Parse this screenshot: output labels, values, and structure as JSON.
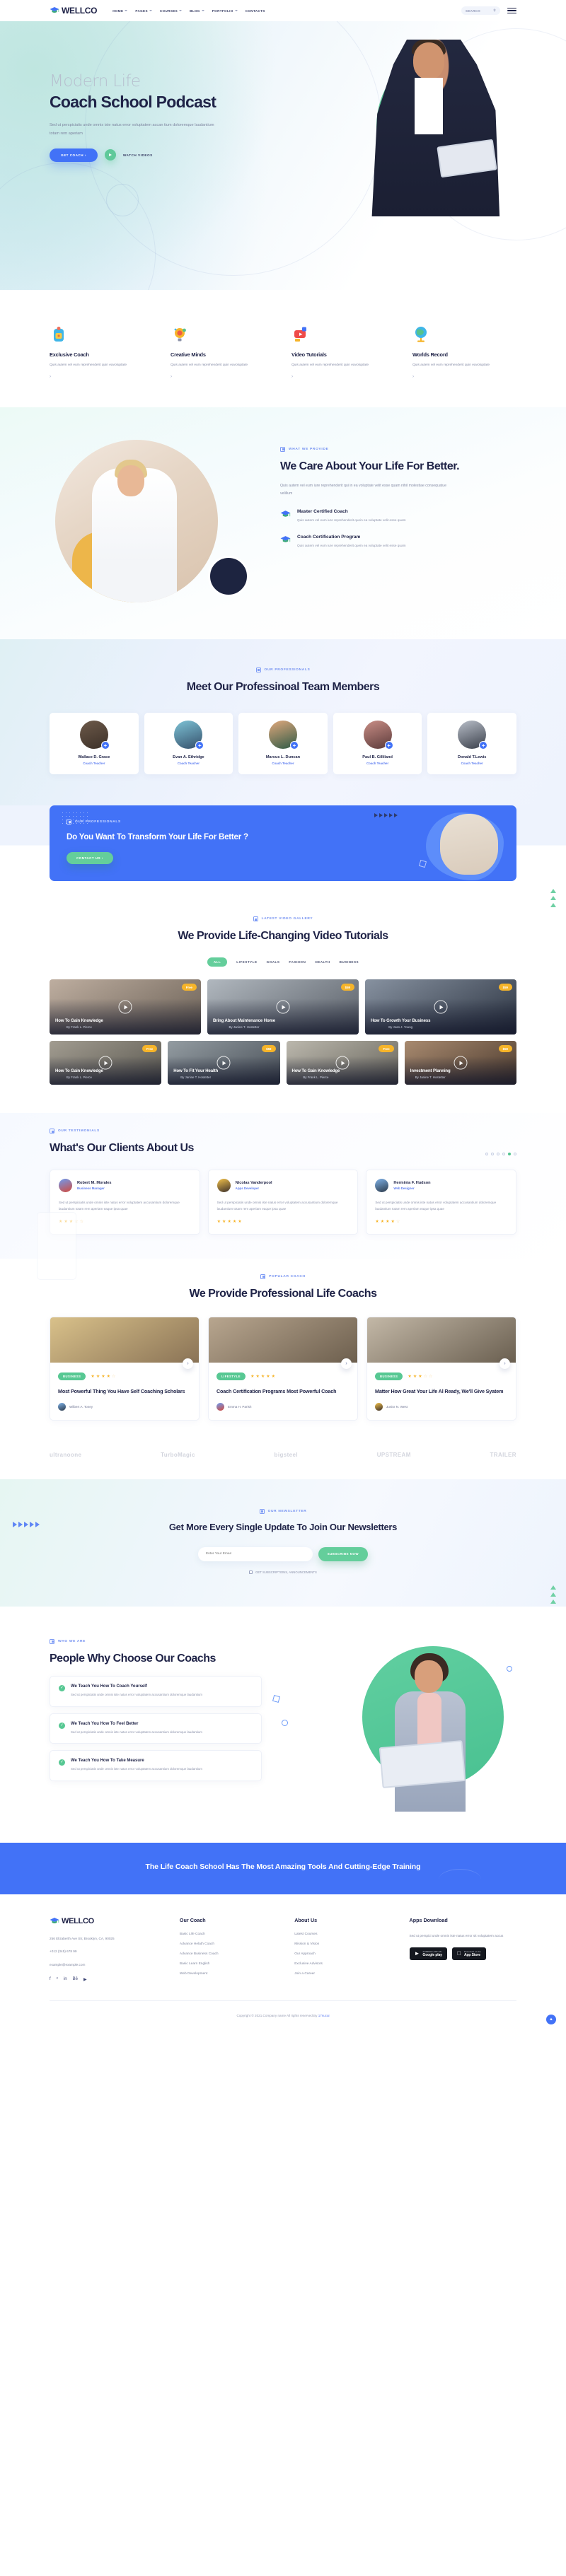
{
  "brand": {
    "name": "WELLCO",
    "accent": "#4272f7",
    "green": "#64ce9b",
    "dark": "#1f2347"
  },
  "header": {
    "nav": [
      {
        "label": "HOME",
        "caret": true
      },
      {
        "label": "PAGES",
        "caret": true
      },
      {
        "label": "COURSES",
        "caret": true
      },
      {
        "label": "BLOG",
        "caret": true
      },
      {
        "label": "PORTFOLIO",
        "caret": true
      },
      {
        "label": "CONTACTS",
        "caret": false
      }
    ],
    "search_label": "SEARCH",
    "search_icon": "search-icon",
    "menu_icon": "hamburger-icon"
  },
  "hero": {
    "kicker": "Modern Life",
    "title": "Coach School Podcast",
    "desc": "Sed ut perspiciatis unde omnis iste natus error voluptatem accan tium doloremque laudantium totam rem aperiam",
    "cta_primary": "GET COACH  ›",
    "cta_secondary": "WATCH VIDEOS"
  },
  "features": [
    {
      "icon": "backpack-icon",
      "title": "Exclusive Coach",
      "desc": "Quis autem vel eum reprehenderit quin eavoluptate",
      "arrow": "›"
    },
    {
      "icon": "lightbulb-icon",
      "title": "Creative Minds",
      "desc": "Quis autem vel eum reprehenderit quin eavoluptate",
      "arrow": "›"
    },
    {
      "icon": "video-icon",
      "title": "Video Tutorials",
      "desc": "Quis autem vel eum reprehenderit quin eavoluptate",
      "arrow": "›"
    },
    {
      "icon": "globe-icon",
      "title": "Worlds Record",
      "desc": "Quis autem vel eum reprehenderit quin eavoluptate",
      "arrow": "›"
    }
  ],
  "about": {
    "eyebrow": "WHAT WE PROVIDE",
    "title": "We Care About Your Life For Better.",
    "desc": "Quis autem vel eum iure reprehenderit qui in ea voluptate velit esse quam nihil molestiae consequatue velillum",
    "items": [
      {
        "icon": "graduation-cap-icon",
        "title": "Master Certified Coach",
        "desc": "Quis autem vel eum iure reprehenderit quein ea voluptate velit esse quam"
      },
      {
        "icon": "graduation-cap-icon",
        "title": "Coach Certification Program",
        "desc": "Quis autem vel eum iure reprehenderit quein ea voluptate velit esse quam"
      }
    ]
  },
  "team": {
    "eyebrow": "OUR PROFESSIONALS",
    "title": "Meet Our Professinoal Team Members",
    "members": [
      {
        "name": "Wallace D. Grace",
        "role": "Coach Teacher"
      },
      {
        "name": "Evan A. Ethridge",
        "role": "Coach Teacher"
      },
      {
        "name": "Marcus L. Duncan",
        "role": "Coach Teacher"
      },
      {
        "name": "Paul B. Gilliland",
        "role": "Coach Teacher"
      },
      {
        "name": "Donald T.Lewis",
        "role": "Coach Teacher"
      }
    ]
  },
  "cta": {
    "eyebrow": "OUR PROFESSIONALS",
    "title": "Do You Want To Transform Your Life For Better ?",
    "button": "CONTACT US  ›"
  },
  "videos": {
    "eyebrow": "LATEST VIDEO GALLERY",
    "title": "We Provide Life-Changing Video Tutorials",
    "filters": [
      "ALL",
      "LIFESTYLE",
      "GOALS",
      "FASHION",
      "HEALTH",
      "BUSINESS"
    ],
    "active_filter": "ALL",
    "row1": [
      {
        "title": "How To Gain Knowledge",
        "by": "By Frank L. Pierce",
        "tag": "Free"
      },
      {
        "title": "Bring About Maintenance Home",
        "by": "By Janine T. Hostetter",
        "tag": "$59"
      },
      {
        "title": "How To Growth Your Business",
        "by": "By Joan J. Young",
        "tag": "$59"
      }
    ],
    "row2": [
      {
        "title": "How To Gain Knowledge",
        "by": "By Frank L. Pierce",
        "tag": "Free"
      },
      {
        "title": "How To Fit Your Health",
        "by": "By Janine T. Hostetter",
        "tag": "$59"
      },
      {
        "title": "How To Gain Knowledge",
        "by": "By Frank L. Pierce",
        "tag": "Free"
      },
      {
        "title": "Investment Planning",
        "by": "By Janine T. Hostetter",
        "tag": "$59"
      }
    ]
  },
  "testimonials": {
    "eyebrow": "OUR TESTIMONIALS",
    "title": "What's Our Clients About Us",
    "dots": [
      false,
      false,
      false,
      false,
      true,
      false
    ],
    "cards": [
      {
        "name": "Robert M. Morales",
        "role": "Business Manager",
        "text": "Sed ut perspiciatis unde omnis iste natus error voluptatem accusantium doloremque laudantium totam rem aperiam eaque ipsa quae",
        "stars": 3
      },
      {
        "name": "Nicolas Vanderpool",
        "role": "Apps Developer",
        "text": "Sed ut perspiciatis unde omnis iste natus error voluptatem accusantium doloremque laudantium totam rem aperiam eaque ipsa quae",
        "stars": 5
      },
      {
        "name": "Herminia F. Hudson",
        "role": "Web Designer",
        "text": "Sed ut perspiciatis unde omnis iste natus error voluptatem accusantium doloremque laudantium totam rem aperiam eaque ipsa quae",
        "stars": 4
      }
    ]
  },
  "coaches": {
    "eyebrow": "POPULAR COACH",
    "title": "We Provide Professional Life Coachs",
    "cards": [
      {
        "tag": "BUSINESS",
        "stars": 4,
        "title": "Most Powerful Thing You Have Self Coaching Scholars",
        "author": "Wilbert A. Toney"
      },
      {
        "tag": "LIFESTYLE",
        "stars": 5,
        "title": "Coach Certification Programs Most Powerful Coach",
        "author": "Emma H. Parish"
      },
      {
        "tag": "BUSINESS",
        "stars": 3,
        "title": "Matter How Great Your Life Al Ready, We'll Give Syatem",
        "author": "Junior N. West"
      }
    ]
  },
  "partners": [
    "ultranoone",
    "TurboMagic",
    "bigsteel",
    "UPSTREAM",
    "TRAILER"
  ],
  "newsletter": {
    "eyebrow": "OUR NEWSLETTER",
    "title": "Get More Every Single Update To Join Our Newsletters",
    "placeholder": "Enter Your Email",
    "button": "SUBSCRIBE NOW",
    "consent": "GET SUBSCRIPTIONS, ANNOUNCEMENTS"
  },
  "why": {
    "eyebrow": "WHO WE ARE",
    "title": "People Why Choose Our Coachs",
    "items": [
      {
        "icon": "check-icon",
        "title": "We Teach You How To Coach Yourself",
        "body": "Sed ut perspiciatis unde omnis iste natus error voluptatem accusantium doloremque laudantium"
      },
      {
        "icon": "check-icon",
        "title": "We Teach You How To Feel Better",
        "body": "Sed ut perspiciatis unde omnis iste natus error voluptatem accusantium doloremque laudantium"
      },
      {
        "icon": "check-icon",
        "title": "We Teach You How To Take Measure",
        "body": "Sed ut perspiciatis unde omnis iste natus error voluptatem accusantium doloremque laudantium"
      }
    ]
  },
  "strip": {
    "title": "The Life Coach School Has The Most Amazing Tools And Cutting-Edge Training"
  },
  "footer": {
    "brand": "WELLCO",
    "address": "256 Elizaberth Ave Str, Brooklyn, CA, 90025",
    "phone": "+012 (345) 678 99",
    "email": "example@example.com",
    "social": [
      "facebook-icon",
      "twitter-icon",
      "linkedin-icon",
      "behance-icon",
      "youtube-icon"
    ],
    "columns": [
      {
        "heading": "Our Coach",
        "links": [
          "Basic Life Coach",
          "Advance Helath Coach",
          "Advance Business Coach",
          "Basic Learn English",
          "Web Development"
        ]
      },
      {
        "heading": "About Us",
        "links": [
          "Latest Courses",
          "Mission & Vision",
          "Our Approach",
          "Exclusive Advisors",
          "Join a Career"
        ]
      }
    ],
    "apps": {
      "heading": "Apps Download",
      "text": "Sed ut perspici unde omnis iste natus error sit voluptatem accus",
      "stores": [
        {
          "small": "ANDROID APP ON",
          "big": "Google play",
          "icon": "google-play-icon"
        },
        {
          "small": "Download on the",
          "big": "App Store",
          "icon": "apple-icon"
        }
      ]
    },
    "copyright_pre": "Copyright © 2021.Company name All rights reserved.By ",
    "copyright_link": "17sucai",
    "scroll_top_icon": "chevron-up-icon"
  }
}
